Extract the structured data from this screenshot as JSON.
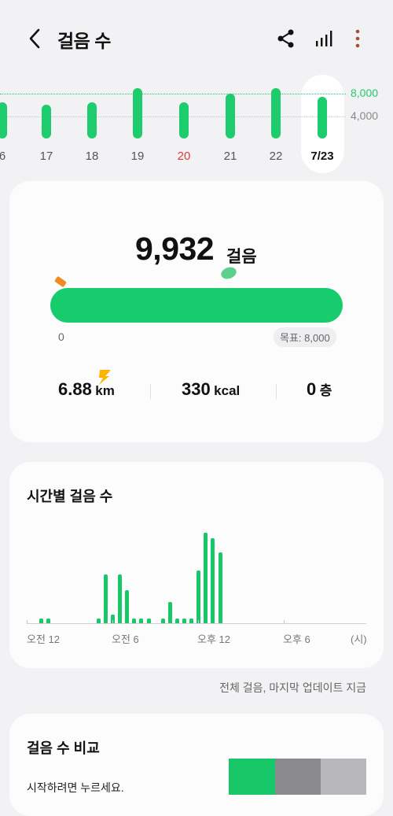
{
  "header": {
    "title": "걸음 수",
    "back_icon": "chevron-left-icon",
    "share_icon": "share-icon",
    "chart_icon": "bar-chart-icon",
    "more_icon": "more-vertical-icon",
    "more_color": "#a0522d"
  },
  "week": {
    "days": [
      {
        "label": "6",
        "steps": 6500,
        "label_color": "#555555"
      },
      {
        "label": "17",
        "steps": 6000,
        "label_color": "#555555"
      },
      {
        "label": "18",
        "steps": 6500,
        "label_color": "#555555"
      },
      {
        "label": "19",
        "steps": 9000,
        "label_color": "#555555"
      },
      {
        "label": "20",
        "steps": 6500,
        "label_color": "#e53935"
      },
      {
        "label": "21",
        "steps": 8000,
        "label_color": "#555555"
      },
      {
        "label": "22",
        "steps": 9000,
        "label_color": "#555555"
      },
      {
        "label": "7/23",
        "steps": 7500,
        "label_color": "#111111",
        "selected": true
      }
    ],
    "goal_label": "8,000",
    "ref_label": "4,000",
    "goal_color": "#1dcc6c"
  },
  "summary": {
    "steps": "9,932",
    "steps_unit": "걸음",
    "progress_start": "0",
    "goal": "목표: 8,000",
    "progress_fraction": 1.0,
    "distance": {
      "value": "6.88",
      "unit": "km"
    },
    "calories": {
      "value": "330",
      "unit": "kcal"
    },
    "floors": {
      "value": "0",
      "unit": "층"
    }
  },
  "hourly": {
    "title": "시간별 걸음 수",
    "x_labels": [
      "오전 12",
      "오전 6",
      "오후 12",
      "오후 6",
      "(시)"
    ]
  },
  "chart_data": {
    "type": "bar",
    "title": "시간별 걸음 수",
    "xlabel": "(시)",
    "ylabel": "",
    "x_ticks": [
      "오전 12",
      "오전 6",
      "오후 12",
      "오후 6"
    ],
    "note": "",
    "x": [
      0,
      1,
      8,
      9,
      10,
      11,
      12,
      13,
      14,
      15,
      17,
      18,
      19,
      20,
      21,
      22,
      23,
      24,
      25,
      26,
      27,
      28,
      29,
      30
    ],
    "values": [
      80,
      80,
      80,
      900,
      160,
      900,
      610,
      80,
      80,
      80,
      80,
      390,
      80,
      80,
      80,
      960,
      1660,
      1560,
      1290,
      0,
      0,
      0,
      0,
      0
    ],
    "ylim": [
      0,
      1800
    ]
  },
  "update_note": "전체 걸음, 마지막 업데이트 지금",
  "compare": {
    "title": "걸음 수 비교",
    "hint": "시작하려면 누르세요.",
    "colors": [
      "#18c768",
      "#8a8a8c",
      "#b8b8ba"
    ]
  }
}
